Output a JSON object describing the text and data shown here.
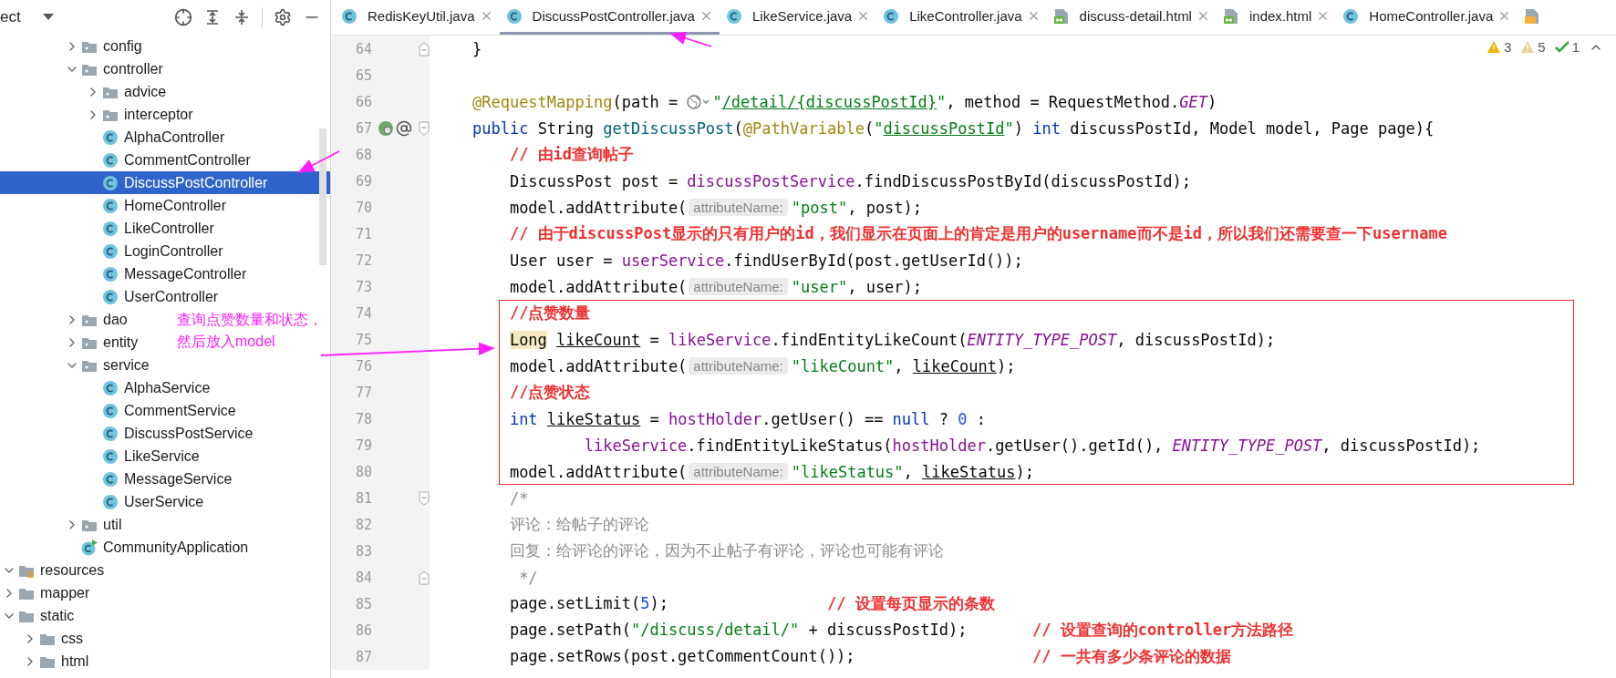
{
  "project_panel": {
    "title": "ect"
  },
  "project_tree": {
    "items": [
      {
        "children": [
          {
            "children": [
              {
                "children": [
                  {
                    "children": [
                      {
                        "label": "config",
                        "kind": "package",
                        "expanded": false,
                        "selected": false
                      },
                      {
                        "label": "controller",
                        "kind": "package",
                        "expanded": true,
                        "selected": false,
                        "children": [
                          {
                            "label": "advice",
                            "kind": "package",
                            "expanded": false,
                            "selected": false
                          },
                          {
                            "label": "interceptor",
                            "kind": "package",
                            "expanded": false,
                            "selected": false
                          },
                          {
                            "label": "AlphaController",
                            "kind": "class",
                            "selected": false
                          },
                          {
                            "label": "CommentController",
                            "kind": "class",
                            "selected": false
                          },
                          {
                            "label": "DiscussPostController",
                            "kind": "class",
                            "selected": true
                          },
                          {
                            "label": "HomeController",
                            "kind": "class",
                            "selected": false
                          },
                          {
                            "label": "LikeController",
                            "kind": "class",
                            "selected": false
                          },
                          {
                            "label": "LoginController",
                            "kind": "class",
                            "selected": false
                          },
                          {
                            "label": "MessageController",
                            "kind": "class",
                            "selected": false
                          },
                          {
                            "label": "UserController",
                            "kind": "class",
                            "selected": false
                          }
                        ]
                      },
                      {
                        "label": "dao",
                        "kind": "package",
                        "expanded": false,
                        "selected": false
                      },
                      {
                        "label": "entity",
                        "kind": "package",
                        "expanded": false,
                        "selected": false
                      },
                      {
                        "label": "service",
                        "kind": "package",
                        "expanded": true,
                        "selected": false,
                        "children": [
                          {
                            "label": "AlphaService",
                            "kind": "class",
                            "selected": false
                          },
                          {
                            "label": "CommentService",
                            "kind": "class",
                            "selected": false
                          },
                          {
                            "label": "DiscussPostService",
                            "kind": "class",
                            "selected": false
                          },
                          {
                            "label": "LikeService",
                            "kind": "class",
                            "selected": false
                          },
                          {
                            "label": "MessageService",
                            "kind": "class",
                            "selected": false
                          },
                          {
                            "label": "UserService",
                            "kind": "class",
                            "selected": false
                          }
                        ]
                      },
                      {
                        "label": "util",
                        "kind": "package",
                        "expanded": false,
                        "selected": false
                      },
                      {
                        "label": "CommunityApplication",
                        "kind": "app",
                        "selected": false
                      }
                    ]
                  }
                ]
              }
            ]
          }
        ]
      },
      {
        "label": "resources",
        "kind": "resources",
        "expanded": true,
        "selected": false,
        "children": [
          {
            "label": "mapper",
            "kind": "folder",
            "expanded": false,
            "selected": false
          },
          {
            "label": "static",
            "kind": "folder",
            "expanded": true,
            "selected": false,
            "children": [
              {
                "label": "css",
                "kind": "folder",
                "expanded": false,
                "selected": false
              },
              {
                "label": "html",
                "kind": "folder",
                "expanded": false,
                "selected": false
              }
            ]
          }
        ]
      }
    ]
  },
  "tabs": [
    {
      "label": "RedisKeyUtil.java",
      "kind": "class",
      "selected": false
    },
    {
      "label": "DiscussPostController.java",
      "kind": "class",
      "selected": true
    },
    {
      "label": "LikeService.java",
      "kind": "class",
      "selected": false
    },
    {
      "label": "LikeController.java",
      "kind": "class",
      "selected": false
    },
    {
      "label": "discuss-detail.html",
      "kind": "html",
      "selected": false
    },
    {
      "label": "index.html",
      "kind": "html",
      "selected": false
    },
    {
      "label": "HomeController.java",
      "kind": "class",
      "selected": false
    },
    {
      "kind": "js",
      "selected": false
    }
  ],
  "inspections": [
    {
      "kind": "warning",
      "count": "3"
    },
    {
      "kind": "weak",
      "count": "5"
    },
    {
      "kind": "ok",
      "count": "1"
    }
  ],
  "editor": {
    "lines_before": [
      {
        "no": "64",
        "fold": {
          "kind": "close"
        },
        "tokens": [
          {
            "t": "    }",
            "kind": "plain"
          }
        ]
      },
      {
        "no": "65"
      },
      {
        "no": "66",
        "tokens": [
          {
            "t": "    @RequestMapping",
            "kind": "anno"
          },
          {
            "t": "(path = ",
            "kind": "plain"
          },
          {
            "kind": "globe"
          },
          {
            "t": "\"",
            "kind": "str"
          },
          {
            "t": "/detail/{discussPostId}",
            "kind": "str_u"
          },
          {
            "t": "\"",
            "kind": "str"
          },
          {
            "t": ", method = RequestMethod.",
            "kind": "plain"
          },
          {
            "t": "GET",
            "kind": "const"
          },
          {
            "t": ")",
            "kind": "plain"
          }
        ]
      },
      {
        "no": "67",
        "fold": {
          "kind": "open"
        },
        "gutter": [
          {
            "kind": "bean"
          },
          {
            "kind": "at"
          }
        ],
        "tokens": [
          {
            "t": "    public",
            "kind": "kw"
          },
          {
            "t": " String ",
            "kind": "plain"
          },
          {
            "t": "getDiscussPost",
            "kind": "decl"
          },
          {
            "t": "(",
            "kind": "plain"
          },
          {
            "t": "@PathVariable",
            "kind": "anno"
          },
          {
            "t": "(",
            "kind": "plain"
          },
          {
            "t": "\"",
            "kind": "str"
          },
          {
            "t": "discussPostId",
            "kind": "str_u"
          },
          {
            "t": "\"",
            "kind": "str"
          },
          {
            "t": ") ",
            "kind": "plain"
          },
          {
            "t": "int",
            "kind": "kw"
          },
          {
            "t": " discussPostId, Model model, Page page){",
            "kind": "plain"
          }
        ]
      },
      {
        "no": "68",
        "tokens": [
          {
            "t": "        // 由id查询帖子",
            "kind": "red"
          }
        ]
      },
      {
        "no": "69",
        "tokens": [
          {
            "t": "        DiscussPost post = ",
            "kind": "plain"
          },
          {
            "t": "discussPostService",
            "kind": "field"
          },
          {
            "t": ".findDiscussPostById(discussPostId);",
            "kind": "plain"
          }
        ]
      },
      {
        "no": "70",
        "tokens": [
          {
            "t": "        model.addAttribute(",
            "kind": "plain"
          },
          {
            "t": "attributeName:",
            "kind": "hint"
          },
          {
            "t": "\"post\"",
            "kind": "str"
          },
          {
            "t": ", post);",
            "kind": "plain"
          }
        ]
      },
      {
        "no": "71",
        "tokens": [
          {
            "t": "        // 由于discussPost显示的只有用户的id，我们显示在页面上的肯定是用户的username而不是id，所以我们还需要查一下username",
            "kind": "red"
          }
        ]
      },
      {
        "no": "72",
        "tokens": [
          {
            "t": "        User user = ",
            "kind": "plain"
          },
          {
            "t": "userService",
            "kind": "field"
          },
          {
            "t": ".findUserById(post.getUserId());",
            "kind": "plain"
          }
        ]
      },
      {
        "no": "73",
        "tokens": [
          {
            "t": "        model.addAttribute(",
            "kind": "plain"
          },
          {
            "t": "attributeName:",
            "kind": "hint"
          },
          {
            "t": "\"user\"",
            "kind": "str"
          },
          {
            "t": ", user);",
            "kind": "plain"
          }
        ]
      }
    ],
    "highlight_box": {
      "lines": [
        {
          "no": "74",
          "tokens": [
            {
              "t": "        //点赞数量",
              "kind": "red"
            }
          ]
        },
        {
          "no": "75",
          "tokens": [
            {
              "t": "        Long",
              "kind": "hl"
            },
            {
              "t": " likeCount",
              "kind": "var_u"
            },
            {
              "t": " = ",
              "kind": "plain"
            },
            {
              "t": "likeService",
              "kind": "field"
            },
            {
              "t": ".findEntityLikeCount(",
              "kind": "plain"
            },
            {
              "t": "ENTITY_TYPE_POST",
              "kind": "const"
            },
            {
              "t": ", discussPostId);",
              "kind": "plain"
            }
          ]
        },
        {
          "no": "76",
          "tokens": [
            {
              "t": "        model.addAttribute(",
              "kind": "plain"
            },
            {
              "t": "attributeName:",
              "kind": "hint"
            },
            {
              "t": "\"likeCount\"",
              "kind": "str"
            },
            {
              "t": ", ",
              "kind": "plain"
            },
            {
              "t": "likeCount",
              "kind": "var_u"
            },
            {
              "t": ");",
              "kind": "plain"
            }
          ]
        },
        {
          "no": "77",
          "tokens": [
            {
              "t": "        //点赞状态",
              "kind": "red"
            }
          ]
        },
        {
          "no": "78",
          "tokens": [
            {
              "t": "        int",
              "kind": "kw"
            },
            {
              "t": " likeStatus",
              "kind": "var_u"
            },
            {
              "t": " = ",
              "kind": "plain"
            },
            {
              "t": "hostHolder",
              "kind": "field"
            },
            {
              "t": ".getUser() == ",
              "kind": "plain"
            },
            {
              "t": "null",
              "kind": "kw"
            },
            {
              "t": " ? ",
              "kind": "plain"
            },
            {
              "t": "0",
              "kind": "num"
            },
            {
              "t": " :",
              "kind": "plain"
            }
          ]
        },
        {
          "no": "79",
          "tokens": [
            {
              "t": "                likeService",
              "kind": "field"
            },
            {
              "t": ".findEntityLikeStatus(",
              "kind": "plain"
            },
            {
              "t": "hostHolder",
              "kind": "field"
            },
            {
              "t": ".getUser().getId(), ",
              "kind": "plain"
            },
            {
              "t": "ENTITY_TYPE_POST",
              "kind": "const"
            },
            {
              "t": ", discussPostId);",
              "kind": "plain"
            }
          ]
        },
        {
          "no": "80",
          "tokens": [
            {
              "t": "        model.addAttribute(",
              "kind": "plain"
            },
            {
              "t": "attributeName:",
              "kind": "hint"
            },
            {
              "t": "\"likeStatus\"",
              "kind": "str"
            },
            {
              "t": ", ",
              "kind": "plain"
            },
            {
              "t": "likeStatus",
              "kind": "var_u"
            },
            {
              "t": ");",
              "kind": "plain"
            }
          ]
        }
      ]
    },
    "lines_after": [
      {
        "no": "81",
        "fold": {
          "kind": "open"
        },
        "tokens": [
          {
            "t": "        /*",
            "kind": "grey"
          }
        ]
      },
      {
        "no": "82",
        "tokens": [
          {
            "t": "        评论：给帖子的评论",
            "kind": "grey"
          }
        ]
      },
      {
        "no": "83",
        "tokens": [
          {
            "t": "        回复：给评论的评论，因为不止帖子有评论，评论也可能有评论",
            "kind": "grey"
          }
        ]
      },
      {
        "no": "84",
        "fold": {
          "kind": "close"
        },
        "tokens": [
          {
            "t": "         */",
            "kind": "grey"
          }
        ]
      },
      {
        "no": "85",
        "tokens": [
          {
            "t": "        page.setLimit(",
            "kind": "plain"
          },
          {
            "t": "5",
            "kind": "num"
          },
          {
            "t": ");",
            "kind": "plain"
          },
          {
            "t": "                 // 设置每页显示的条数",
            "kind": "red"
          }
        ]
      },
      {
        "no": "86",
        "tokens": [
          {
            "t": "        page.setPath(",
            "kind": "plain"
          },
          {
            "t": "\"/discuss/detail/\"",
            "kind": "str"
          },
          {
            "t": " + discussPostId);",
            "kind": "plain"
          },
          {
            "t": "       // 设置查询的controller方法路径",
            "kind": "red"
          }
        ]
      },
      {
        "no": "87",
        "tokens": [
          {
            "t": "        page.setRows(post.getCommentCount());",
            "kind": "plain"
          },
          {
            "t": "                   // 一共有多少条评论的数据",
            "kind": "red"
          }
        ]
      }
    ]
  },
  "annotation": {
    "callout": [
      "查询点赞数量和状态，",
      "然后放入model"
    ]
  }
}
